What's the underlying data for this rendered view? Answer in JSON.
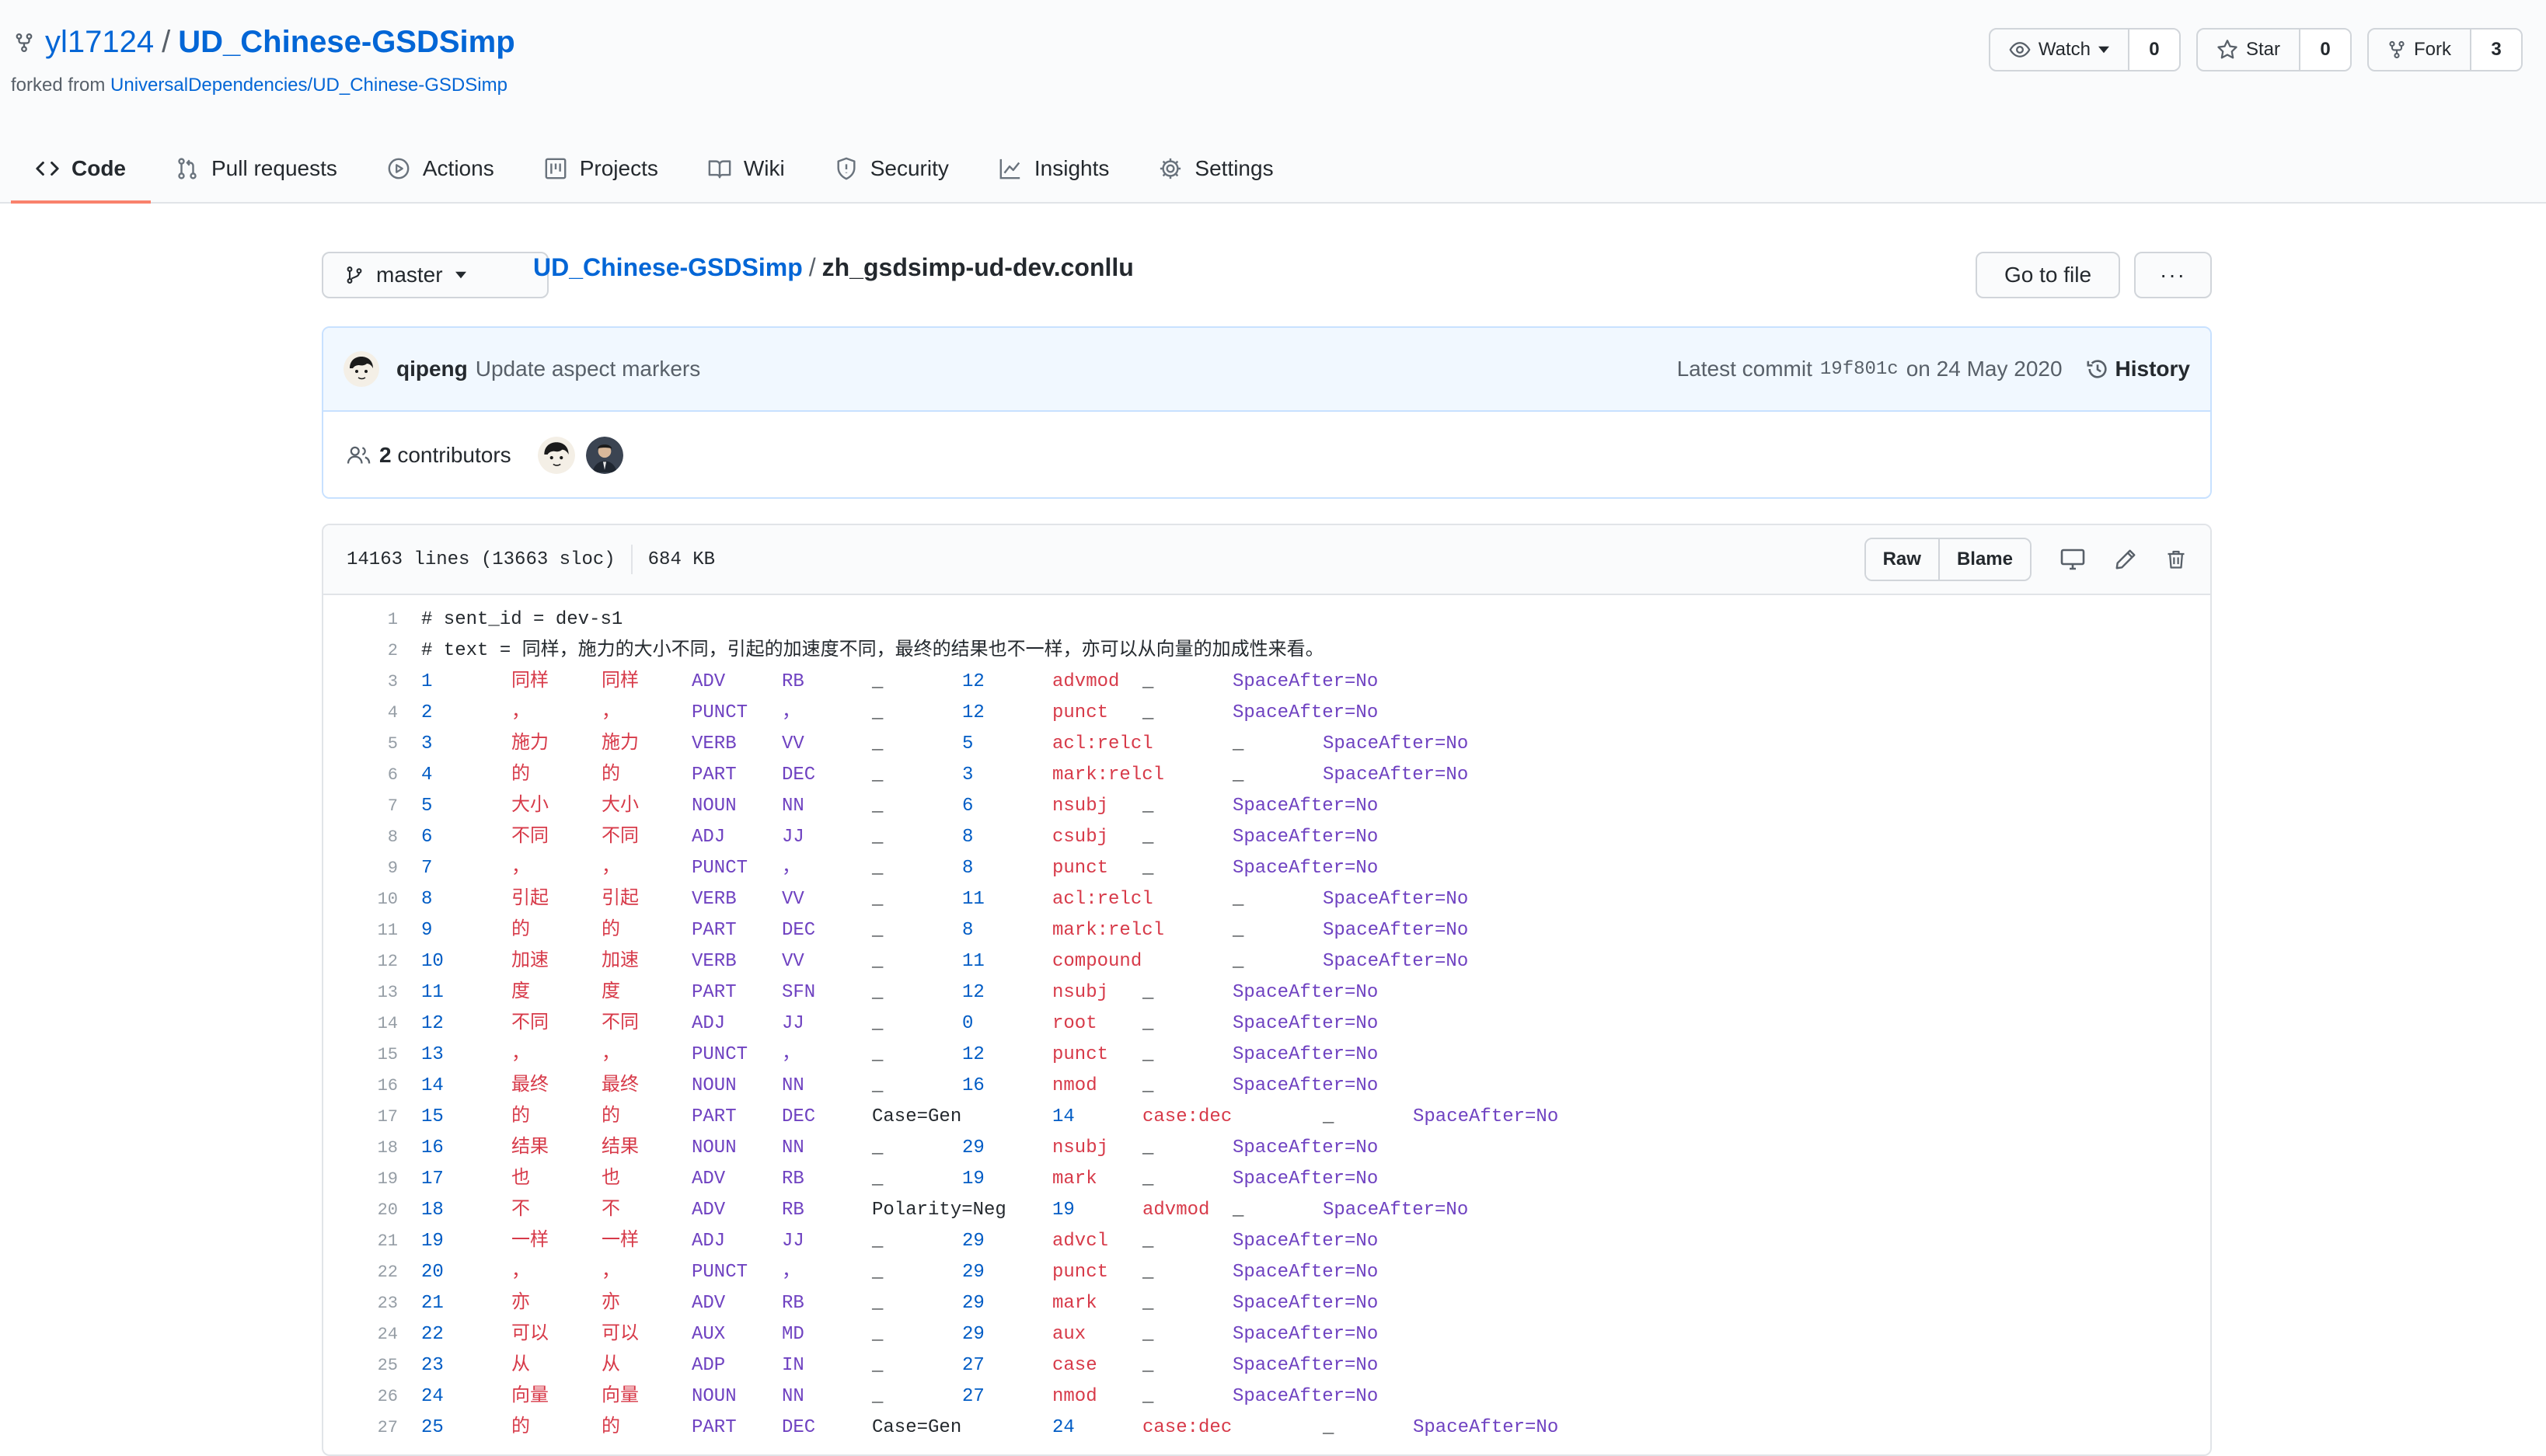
{
  "repo": {
    "owner": "yl17124",
    "separator": "/",
    "name": "UD_Chinese-GSDSimp",
    "forked_label": "forked from",
    "forked_from": "UniversalDependencies/UD_Chinese-GSDSimp"
  },
  "header_actions": {
    "watch": {
      "label": "Watch",
      "count": "0"
    },
    "star": {
      "label": "Star",
      "count": "0"
    },
    "fork": {
      "label": "Fork",
      "count": "3"
    }
  },
  "tabs": [
    {
      "label": "Code",
      "icon": "code-icon"
    },
    {
      "label": "Pull requests",
      "icon": "pull-request-icon"
    },
    {
      "label": "Actions",
      "icon": "play-icon"
    },
    {
      "label": "Projects",
      "icon": "project-icon"
    },
    {
      "label": "Wiki",
      "icon": "book-icon"
    },
    {
      "label": "Security",
      "icon": "shield-icon"
    },
    {
      "label": "Insights",
      "icon": "graph-icon"
    },
    {
      "label": "Settings",
      "icon": "gear-icon"
    }
  ],
  "file_nav": {
    "branch": "master",
    "root": "UD_Chinese-GSDSimp",
    "slash": "/",
    "file": "zh_gsdsimp-ud-dev.conllu",
    "go_to_file": "Go to file",
    "more": "···"
  },
  "commit": {
    "author": "qipeng",
    "message": "Update aspect markers",
    "latest_label": "Latest commit",
    "sha": "19f801c",
    "date": "on 24 May 2020",
    "history": "History",
    "contributors_count": "2",
    "contributors_label": "contributors"
  },
  "file_header": {
    "lines": "14163 lines (13663 sloc)",
    "size": "684 KB",
    "raw": "Raw",
    "blame": "Blame"
  },
  "code": {
    "comments": [
      {
        "n": "1",
        "text": "# sent_id = dev-s1"
      },
      {
        "n": "2",
        "text": "# text = 同样，施力的大小不同，引起的加速度不同，最终的结果也不一样，亦可以从向量的加成性来看。"
      }
    ],
    "rows": [
      {
        "n": "3",
        "cols": [
          "1",
          "同样",
          "同样",
          "ADV",
          "RB",
          "_",
          "12",
          "advmod",
          "_",
          "SpaceAfter=No"
        ]
      },
      {
        "n": "4",
        "cols": [
          "2",
          "，",
          "，",
          "PUNCT",
          "，",
          "_",
          "12",
          "punct",
          "_",
          "SpaceAfter=No"
        ]
      },
      {
        "n": "5",
        "cols": [
          "3",
          "施力",
          "施力",
          "VERB",
          "VV",
          "_",
          "5",
          "acl:relcl",
          "_",
          "SpaceAfter=No"
        ]
      },
      {
        "n": "6",
        "cols": [
          "4",
          "的",
          "的",
          "PART",
          "DEC",
          "_",
          "3",
          "mark:relcl",
          "_",
          "SpaceAfter=No"
        ]
      },
      {
        "n": "7",
        "cols": [
          "5",
          "大小",
          "大小",
          "NOUN",
          "NN",
          "_",
          "6",
          "nsubj",
          "_",
          "SpaceAfter=No"
        ]
      },
      {
        "n": "8",
        "cols": [
          "6",
          "不同",
          "不同",
          "ADJ",
          "JJ",
          "_",
          "8",
          "csubj",
          "_",
          "SpaceAfter=No"
        ]
      },
      {
        "n": "9",
        "cols": [
          "7",
          "，",
          "，",
          "PUNCT",
          "，",
          "_",
          "8",
          "punct",
          "_",
          "SpaceAfter=No"
        ]
      },
      {
        "n": "10",
        "cols": [
          "8",
          "引起",
          "引起",
          "VERB",
          "VV",
          "_",
          "11",
          "acl:relcl",
          "_",
          "SpaceAfter=No"
        ]
      },
      {
        "n": "11",
        "cols": [
          "9",
          "的",
          "的",
          "PART",
          "DEC",
          "_",
          "8",
          "mark:relcl",
          "_",
          "SpaceAfter=No"
        ]
      },
      {
        "n": "12",
        "cols": [
          "10",
          "加速",
          "加速",
          "VERB",
          "VV",
          "_",
          "11",
          "compound",
          "_",
          "SpaceAfter=No"
        ]
      },
      {
        "n": "13",
        "cols": [
          "11",
          "度",
          "度",
          "PART",
          "SFN",
          "_",
          "12",
          "nsubj",
          "_",
          "SpaceAfter=No"
        ]
      },
      {
        "n": "14",
        "cols": [
          "12",
          "不同",
          "不同",
          "ADJ",
          "JJ",
          "_",
          "0",
          "root",
          "_",
          "SpaceAfter=No"
        ]
      },
      {
        "n": "15",
        "cols": [
          "13",
          "，",
          "，",
          "PUNCT",
          "，",
          "_",
          "12",
          "punct",
          "_",
          "SpaceAfter=No"
        ]
      },
      {
        "n": "16",
        "cols": [
          "14",
          "最终",
          "最终",
          "NOUN",
          "NN",
          "_",
          "16",
          "nmod",
          "_",
          "SpaceAfter=No"
        ]
      },
      {
        "n": "17",
        "cols": [
          "15",
          "的",
          "的",
          "PART",
          "DEC",
          "Case=Gen",
          "14",
          "case:dec",
          "_",
          "SpaceAfter=No"
        ]
      },
      {
        "n": "18",
        "cols": [
          "16",
          "结果",
          "结果",
          "NOUN",
          "NN",
          "_",
          "29",
          "nsubj",
          "_",
          "SpaceAfter=No"
        ]
      },
      {
        "n": "19",
        "cols": [
          "17",
          "也",
          "也",
          "ADV",
          "RB",
          "_",
          "19",
          "mark",
          "_",
          "SpaceAfter=No"
        ]
      },
      {
        "n": "20",
        "cols": [
          "18",
          "不",
          "不",
          "ADV",
          "RB",
          "Polarity=Neg",
          "19",
          "advmod",
          "_",
          "SpaceAfter=No"
        ]
      },
      {
        "n": "21",
        "cols": [
          "19",
          "一样",
          "一样",
          "ADJ",
          "JJ",
          "_",
          "29",
          "advcl",
          "_",
          "SpaceAfter=No"
        ]
      },
      {
        "n": "22",
        "cols": [
          "20",
          "，",
          "，",
          "PUNCT",
          "，",
          "_",
          "29",
          "punct",
          "_",
          "SpaceAfter=No"
        ]
      },
      {
        "n": "23",
        "cols": [
          "21",
          "亦",
          "亦",
          "ADV",
          "RB",
          "_",
          "29",
          "mark",
          "_",
          "SpaceAfter=No"
        ]
      },
      {
        "n": "24",
        "cols": [
          "22",
          "可以",
          "可以",
          "AUX",
          "MD",
          "_",
          "29",
          "aux",
          "_",
          "SpaceAfter=No"
        ]
      },
      {
        "n": "25",
        "cols": [
          "23",
          "从",
          "从",
          "ADP",
          "IN",
          "_",
          "27",
          "case",
          "_",
          "SpaceAfter=No"
        ]
      },
      {
        "n": "26",
        "cols": [
          "24",
          "向量",
          "向量",
          "NOUN",
          "NN",
          "_",
          "27",
          "nmod",
          "_",
          "SpaceAfter=No"
        ]
      },
      {
        "n": "27",
        "cols": [
          "25",
          "的",
          "的",
          "PART",
          "DEC",
          "Case=Gen",
          "24",
          "case:dec",
          "_",
          "SpaceAfter=No"
        ]
      }
    ]
  }
}
